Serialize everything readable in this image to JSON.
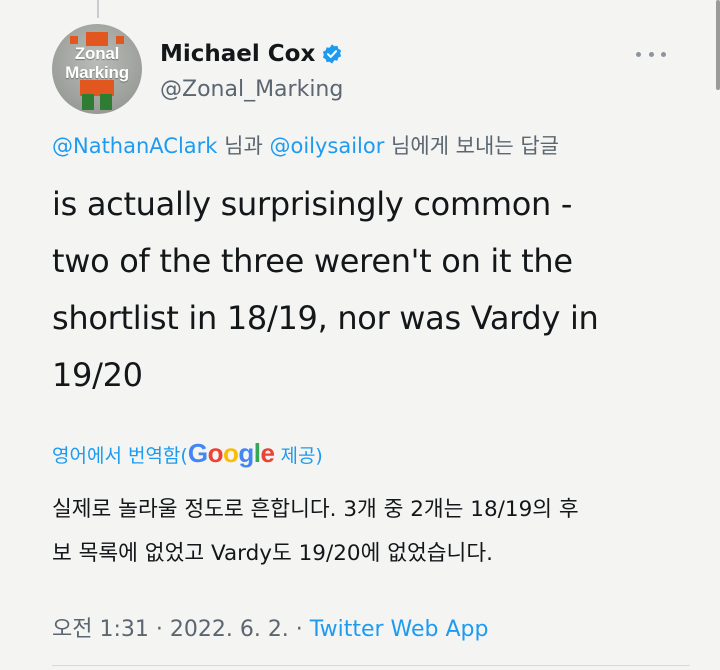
{
  "colors": {
    "link": "#1d9bf0",
    "secondary_text": "#5b6670",
    "primary_text": "#14171a",
    "verified_badge": "#1d9bf0",
    "background": "#f4f4f2"
  },
  "author": {
    "display_name": "Michael Cox",
    "handle": "@Zonal_Marking",
    "avatar_text_line1": "Zonal",
    "avatar_text_line2": "Marking",
    "verified_icon": "verified-badge-icon",
    "more_icon": "more-options-icon"
  },
  "reply_to": {
    "mention1": "@NathanAClark",
    "connector": " 님과 ",
    "mention2": "@oilysailor",
    "suffix": " 님에게 보내는 답글"
  },
  "tweet": {
    "lines": [
      "is actually surprisingly common -",
      "two of the three weren't on it the",
      "shortlist in 18/19, nor was Vardy in",
      "19/20"
    ]
  },
  "translation": {
    "prefix": "영어에서 번역함(",
    "brand_letters": [
      "G",
      "o",
      "o",
      "g",
      "l",
      "e"
    ],
    "brand_colors": [
      "#4285f4",
      "#ea4335",
      "#fbbc05",
      "#4285f4",
      "#34a853",
      "#ea4335"
    ],
    "suffix": " 제공)",
    "lines": [
      "실제로 놀라울 정도로 흔합니다. 3개 중 2개는 18/19의 후",
      "보 목록에 없었고 Vardy도 19/20에 없었습니다."
    ]
  },
  "meta": {
    "time": "오전 1:31 · 2022. 6. 2. · ",
    "source": "Twitter Web App"
  }
}
